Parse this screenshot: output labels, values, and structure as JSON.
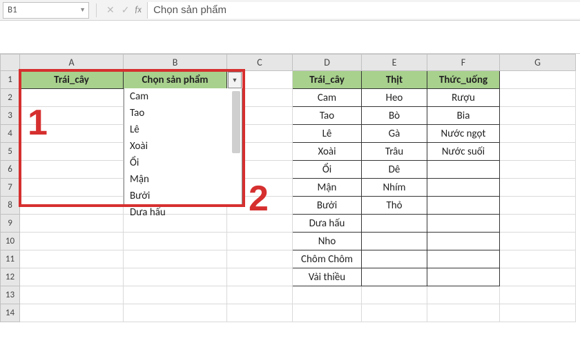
{
  "formula_bar": {
    "cell_ref": "B1",
    "fx_label": "fx",
    "value": "Chọn sản phẩm"
  },
  "columns": [
    "A",
    "B",
    "C",
    "D",
    "E",
    "F",
    "G"
  ],
  "rows": [
    "1",
    "2",
    "3",
    "4",
    "5",
    "6",
    "7",
    "8",
    "9",
    "10",
    "11",
    "12",
    "13",
    "14"
  ],
  "cells": {
    "A1": "Trái_cây",
    "B1": "Chọn sản phẩm",
    "D1": "Trái_cây",
    "E1": "Thịt",
    "F1": "Thức_uống",
    "D2": "Cam",
    "E2": "Heo",
    "F2": "Rượu",
    "D3": "Tao",
    "E3": "Bò",
    "F3": "Bia",
    "D4": "Lê",
    "E4": "Gà",
    "F4": "Nước ngọt",
    "D5": "Xoài",
    "E5": "Trâu",
    "F5": "Nước suối",
    "D6": "Ổi",
    "E6": "Dê",
    "D7": "Mận",
    "E7": "Nhím",
    "D8": "Bưởi",
    "E8": "Thỏ",
    "D9": "Dưa hấu",
    "D10": "Nho",
    "D11": "Chôm Chôm",
    "D12": "Vải thiều"
  },
  "dropdown": {
    "items": [
      "Cam",
      "Tao",
      "Lê",
      "Xoài",
      "Ổi",
      "Mận",
      "Bưởi",
      "Dưa hấu"
    ]
  },
  "annotations": {
    "one": "1",
    "two": "2"
  },
  "icons": {
    "dropdown": "▼",
    "cancel": "✕",
    "confirm": "✓"
  }
}
